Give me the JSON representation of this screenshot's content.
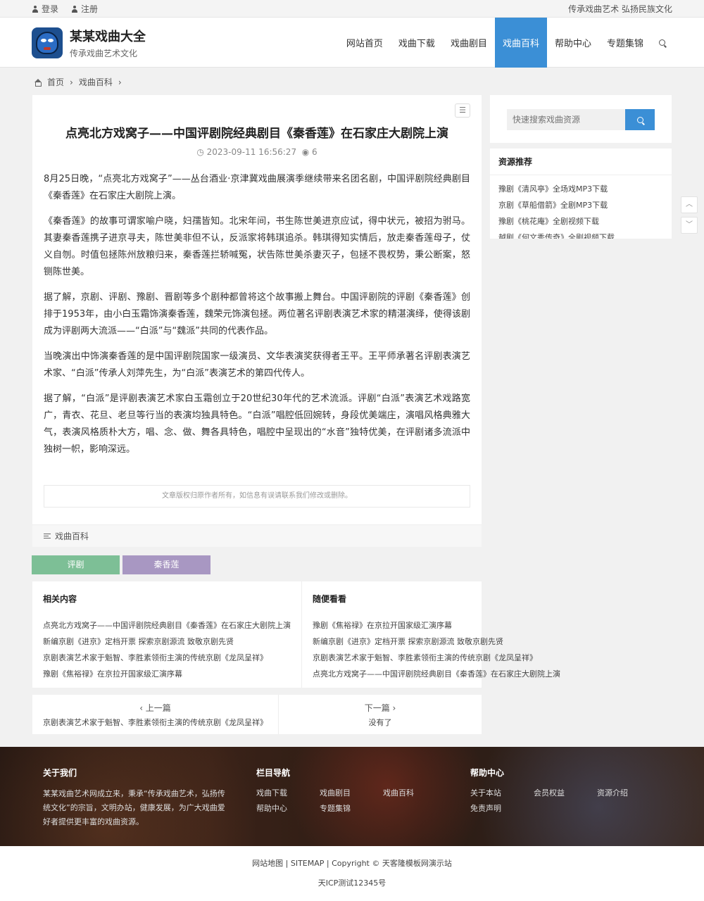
{
  "topbar": {
    "login": "登录",
    "register": "注册",
    "slogan": "传承戏曲艺术 弘扬民族文化"
  },
  "brand": {
    "title": "某某戏曲大全",
    "subtitle": "传承戏曲艺术文化"
  },
  "nav": {
    "items": [
      "网站首页",
      "戏曲下载",
      "戏曲剧目",
      "戏曲百科",
      "帮助中心",
      "专题集锦"
    ],
    "active": "戏曲百科"
  },
  "breadcrumb": {
    "home": "首页",
    "category": "戏曲百科",
    "sep": "›"
  },
  "article": {
    "title": "点亮北方戏窝子——中国评剧院经典剧目《秦香莲》在石家庄大剧院上演",
    "date": "2023-09-11 16:56:27",
    "views": "6",
    "paragraphs": [
      "8月25日晚，“点亮北方戏窝子”——丛台酒业·京津冀戏曲展演季继续带来名团名剧，中国评剧院经典剧目《秦香莲》在石家庄大剧院上演。",
      "《秦香莲》的故事可谓家喻户晓，妇孺皆知。北宋年间，书生陈世美进京应试，得中状元，被招为驸马。其妻秦香莲携子进京寻夫，陈世美非但不认，反派家将韩琪追杀。韩琪得知实情后，放走秦香莲母子，仗义自刎。时值包拯陈州放粮归来，秦香莲拦轿喊冤，状告陈世美杀妻灭子，包拯不畏权势，秉公断案，怒铡陈世美。",
      "据了解，京剧、评剧、豫剧、晋剧等多个剧种都曾将这个故事搬上舞台。中国评剧院的评剧《秦香莲》创排于1953年，由小白玉霜饰演秦香莲，魏荣元饰演包拯。两位著名评剧表演艺术家的精湛演绎，使得该剧成为评剧两大流派——“白派”与“魏派”共同的代表作品。",
      "当晚演出中饰演秦香莲的是中国评剧院国家一级演员、文华表演奖获得者王平。王平师承著名评剧表演艺术家、“白派”传承人刘萍先生，为“白派”表演艺术的第四代传人。",
      "据了解，“白派”是评剧表演艺术家白玉霜创立于20世纪30年代的艺术流派。评剧“白派”表演艺术戏路宽广，青衣、花旦、老旦等行当的表演均独具特色。“白派”唱腔低回婉转，身段优美端庄，演唱风格典雅大气，表演风格质朴大方，唱、念、做、舞各具特色，唱腔中呈现出的“水音”独特优美，在评剧诸多流派中独树一帜，影响深远。"
    ],
    "copyright": "文章版权归原作者所有，如信息有误请联系我们修改或删除。",
    "category": "戏曲百科"
  },
  "tags": [
    {
      "label": "评剧",
      "color": "#7dbf96"
    },
    {
      "label": "秦香莲",
      "color": "#a897c2"
    }
  ],
  "related": {
    "title": "相关内容",
    "items": [
      "点亮北方戏窝子——中国评剧院经典剧目《秦香莲》在石家庄大剧院上演",
      "新编京剧《进京》定档开票 探索京剧源流 致敬京剧先贤",
      "京剧表演艺术家于魁智、李胜素领衔主演的传统京剧《龙凤呈祥》",
      "豫剧《焦裕禄》在京拉开国家级汇演序幕"
    ]
  },
  "random": {
    "title": "随便看看",
    "items": [
      "豫剧《焦裕禄》在京拉开国家级汇演序幕",
      "新编京剧《进京》定档开票 探索京剧源流 致敬京剧先贤",
      "京剧表演艺术家于魁智、李胜素领衔主演的传统京剧《龙凤呈祥》",
      "点亮北方戏窝子——中国评剧院经典剧目《秦香莲》在石家庄大剧院上演"
    ]
  },
  "prevnext": {
    "prev_label": "‹ 上一篇",
    "prev_title": "京剧表演艺术家于魁智、李胜素领衔主演的传统京剧《龙凤呈祥》",
    "next_label": "下一篇 ›",
    "next_title": "没有了"
  },
  "sidebar": {
    "search_placeholder": "快速搜索戏曲资源",
    "rec_title": "资源推荐",
    "rec_items": [
      "豫剧《清风亭》全场戏MP3下载",
      "京剧《草船借箭》全剧MP3下载",
      "豫剧《桃花庵》全剧视频下载",
      "越剧《何文秀传奇》全剧视频下载"
    ]
  },
  "scroll": {
    "up": "︿",
    "down": "﹀"
  },
  "footer": {
    "about_title": "关于我们",
    "about_text": "某某戏曲艺术网成立来，秉承“传承戏曲艺术，弘扬传统文化”的宗旨，文明办站，健康发展，为广大戏曲爱好者提供更丰富的戏曲资源。",
    "nav_title": "栏目导航",
    "nav_items": [
      "戏曲下载",
      "戏曲剧目",
      "戏曲百科",
      "帮助中心",
      "专题集锦"
    ],
    "help_title": "帮助中心",
    "help_items": [
      "关于本站",
      "会员权益",
      "资源介绍",
      "免责声明"
    ]
  },
  "bottom": {
    "line1": "网站地图 | SITEMAP | Copyright © 天客隆模板网演示站",
    "line2": "天ICP测试12345号"
  }
}
